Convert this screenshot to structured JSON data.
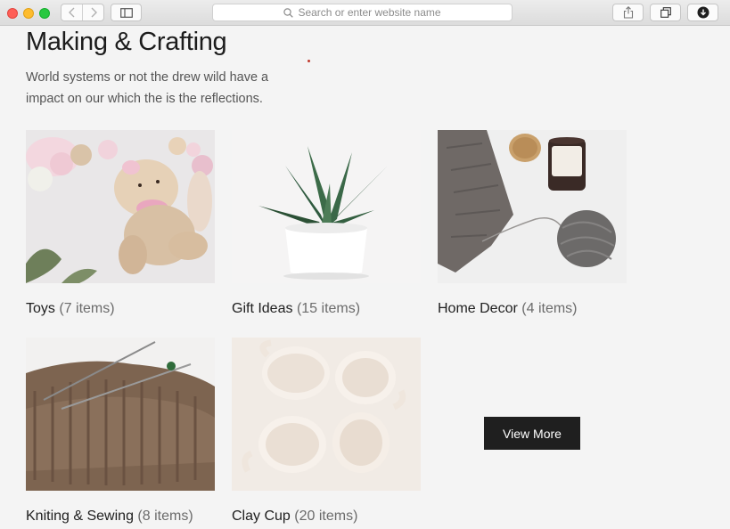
{
  "browser": {
    "address_placeholder": "Search or enter website name",
    "icons": [
      "back-icon",
      "forward-icon",
      "sidebar-icon",
      "search-icon",
      "share-icon",
      "tabs-icon",
      "download-icon"
    ]
  },
  "section": {
    "title": "Making & Crafting",
    "description": "World systems or not the drew wild have a impact on our which the is the reflections."
  },
  "categories": [
    {
      "name": "Toys",
      "count": "(7 items)"
    },
    {
      "name": "Gift Ideas",
      "count": "(15 items)"
    },
    {
      "name": "Home Decor",
      "count": "(4 items)"
    },
    {
      "name": "Kniting & Sewing",
      "count": "(8 items)"
    },
    {
      "name": "Clay Cup",
      "count": "(20 items)"
    }
  ],
  "view_more_label": "View More",
  "colors": {
    "page_bg": "#f4f4f4",
    "button_bg": "#1f1f1f",
    "button_text": "#ffffff",
    "title": "#1c1c1c",
    "muted": "#6b6b6b"
  }
}
